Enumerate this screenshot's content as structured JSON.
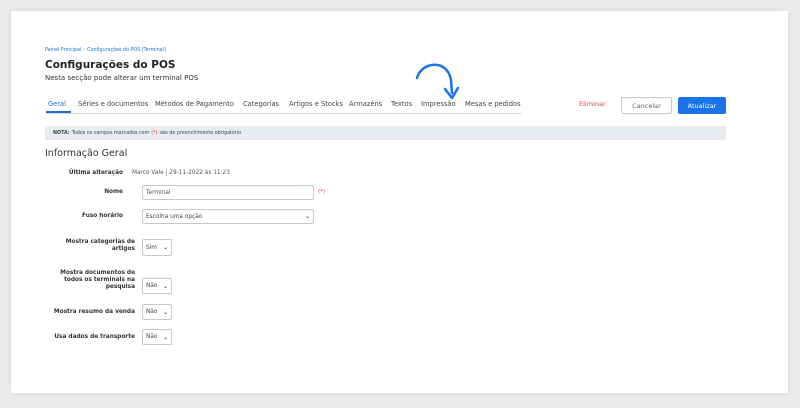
{
  "breadcrumb": {
    "item1": "Painel Principal",
    "sep": "›",
    "item2": "Configurações do POS [Terminal]"
  },
  "header": {
    "title": "Configurações do POS",
    "subtitle": "Nesta secção pode alterar um terminal POS"
  },
  "tabs": [
    {
      "label": "Geral",
      "active": true
    },
    {
      "label": "Séries e documentos"
    },
    {
      "label": "Métodos de Pagamento"
    },
    {
      "label": "Categorias"
    },
    {
      "label": "Artigos e Stocks"
    },
    {
      "label": "Armazéns"
    },
    {
      "label": "Textos"
    },
    {
      "label": "Impressão"
    },
    {
      "label": "Mesas e pedidos"
    }
  ],
  "actions": {
    "delete_label": "Eliminar",
    "cancel_label": "Cancelar",
    "update_label": "Atualizar"
  },
  "notice": {
    "prefix": "NOTA:",
    "text_before": "Todos os campos marcados com",
    "mark": "(*)",
    "text_after": "são de preenchimento obrigatório"
  },
  "section": {
    "title": "Informação Geral"
  },
  "form": {
    "last_change": {
      "label": "Última alteração",
      "value": "Marco Vale | 29-11-2022 às 11:23"
    },
    "name": {
      "label": "Nome",
      "value": "Terminal",
      "required_mark": "(*)"
    },
    "timezone": {
      "label": "Fuso horário",
      "value": "Escolha uma opção"
    },
    "show_categories": {
      "label": "Mostra categorias de artigos",
      "value": "Sim"
    },
    "show_all_docs": {
      "label": "Mostra documentos de todos os terminais na pesquisa",
      "value": "Não"
    },
    "show_sale_summary": {
      "label": "Mostra resumo da venda",
      "value": "Não"
    },
    "use_transport": {
      "label": "Usa dados de transporte",
      "value": "Não"
    }
  },
  "colors": {
    "accent": "#1a73e8",
    "danger": "#e04040",
    "notice_bg": "#e8ebef"
  },
  "icons": {
    "annotation": "curved-arrow-icon",
    "dropdown": "chevron-down-icon"
  }
}
